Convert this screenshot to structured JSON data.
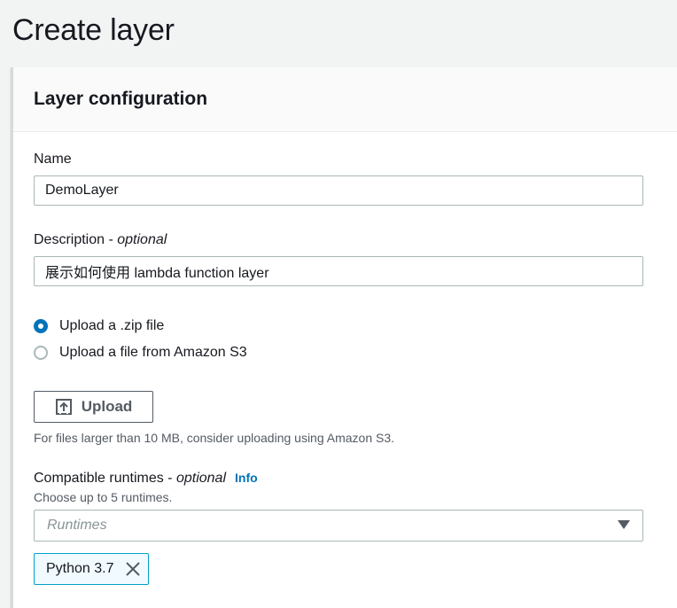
{
  "page": {
    "title": "Create layer"
  },
  "panel": {
    "title": "Layer configuration"
  },
  "name_field": {
    "label": "Name",
    "value": "DemoLayer"
  },
  "description_field": {
    "label_main": "Description - ",
    "label_suffix": "optional",
    "value": "展示如何使用 lambda function layer"
  },
  "upload_options": [
    {
      "label": "Upload a .zip file",
      "selected": true
    },
    {
      "label": "Upload a file from Amazon S3",
      "selected": false
    }
  ],
  "upload": {
    "button_label": "Upload",
    "hint": "For files larger than 10 MB, consider uploading using Amazon S3."
  },
  "runtimes": {
    "label_main": "Compatible runtimes - ",
    "label_suffix": "optional",
    "info_link": "Info",
    "hint": "Choose up to 5 runtimes.",
    "placeholder": "Runtimes",
    "selected_tokens": [
      "Python 3.7"
    ]
  },
  "colors": {
    "accent": "#0073bb",
    "border": "#aab7b8",
    "token_border": "#00a1c9",
    "token_bg": "#f1faff"
  }
}
